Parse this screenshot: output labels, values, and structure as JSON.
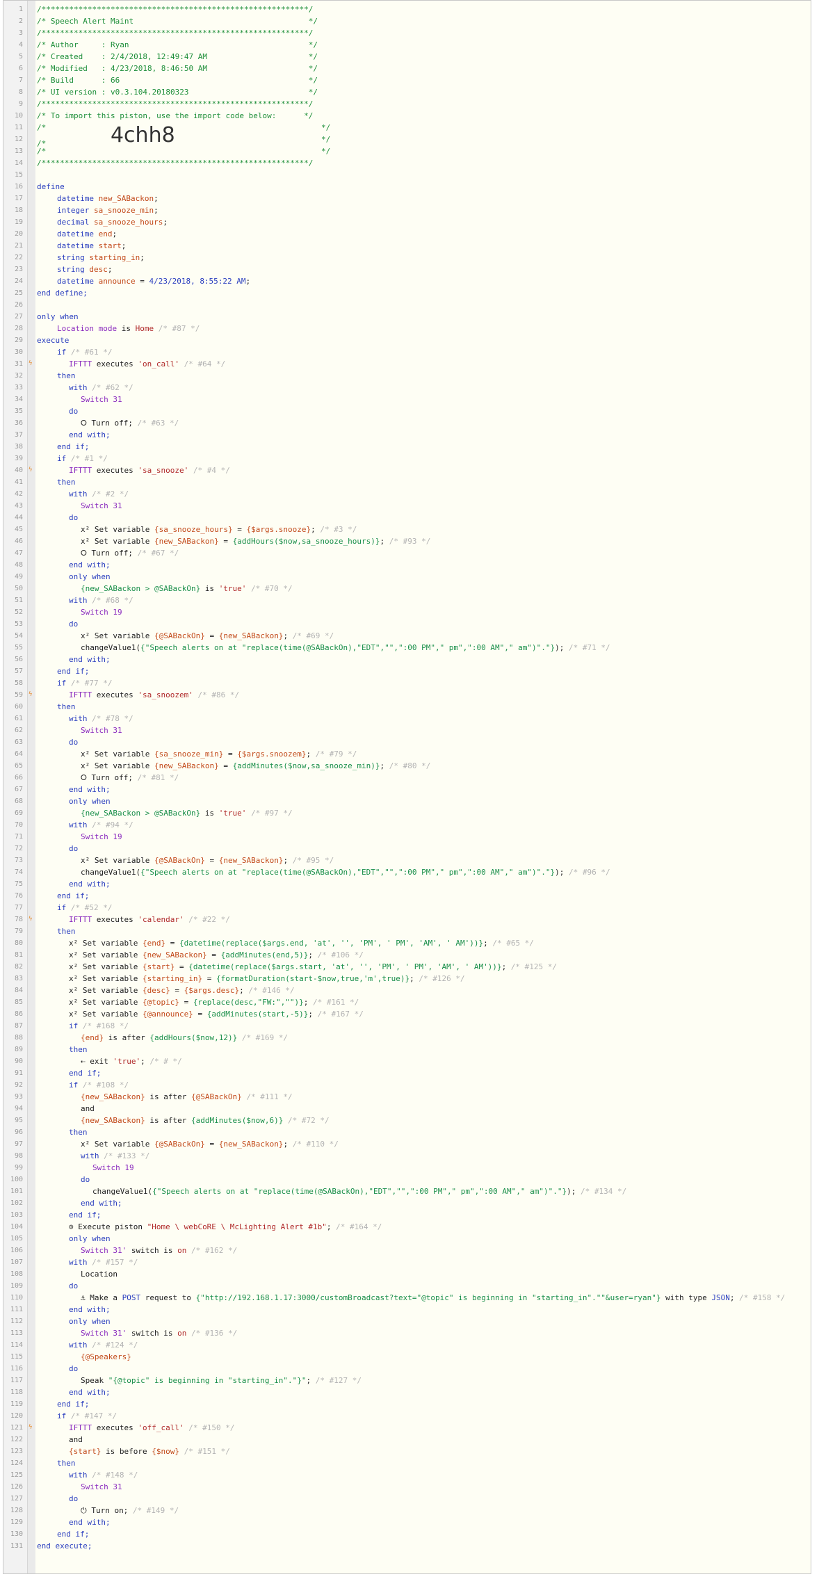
{
  "colors": {
    "comment": "#1f8f3a",
    "keyword": "#2b3fbf",
    "variable": "#c24a1a",
    "device": "#8a2bbe",
    "string": "#b02a2a",
    "expression": "#1a8f4a",
    "hint": "#b3b3b3"
  },
  "header": {
    "l1": "/**********************************************************/",
    "l2": "/* Speech Alert Maint                                      */",
    "l3": "/**********************************************************/",
    "l4": "/* Author     : Ryan                                       */",
    "l5": "/* Created    : 2/4/2018, 12:49:47 AM                      */",
    "l6": "/* Modified   : 4/23/2018, 8:46:50 AM                      */",
    "l7": "/* Build      : 66                                         */",
    "l8": "/* UI version : v0.3.104.20180323                          */",
    "l9": "/**********************************************************/",
    "l10": "/* To import this piston, use the import code below:      */",
    "l11a": "/*",
    "l11b": "*/",
    "l12a": "/*",
    "l12b": "*/",
    "l13a": "/*",
    "l13b": "*/",
    "import_code": "4chh8",
    "l14": "/**********************************************************/"
  },
  "define": {
    "open": "define",
    "close": "end define;",
    "vars": [
      {
        "type": "datetime",
        "name": "new_SABackon"
      },
      {
        "type": "integer",
        "name": "sa_snooze_min"
      },
      {
        "type": "decimal",
        "name": "sa_snooze_hours"
      },
      {
        "type": "datetime",
        "name": "end"
      },
      {
        "type": "datetime",
        "name": "start"
      },
      {
        "type": "string",
        "name": "starting_in"
      },
      {
        "type": "string",
        "name": "desc"
      }
    ],
    "announce": {
      "type": "datetime",
      "name": "announce",
      "value": "4/23/2018, 8:55:22 AM"
    }
  },
  "only_when": {
    "kw": "only when",
    "subject": "Location mode",
    "is": "is",
    "value": "Home",
    "id": "/* #87 */"
  },
  "lines": {
    "execute": "execute",
    "end_execute": "end execute;",
    "if": "if",
    "then": "then",
    "end_if": "end if;",
    "with": "with",
    "do": "do",
    "end_with": "end with;",
    "only_when": "only when",
    "and": "and",
    "switch31": "Switch 31",
    "switch19": "Switch 19",
    "ifttt": "IFTTT",
    "executes": "executes",
    "turn_off": "Turn off;",
    "turn_on": "Turn on;",
    "set_variable": "Set variable",
    "is_true": "is",
    "true_str": "'true'",
    "is_after": "is after",
    "is_before": "is before",
    "location": "Location",
    "speakers": "{@Speakers}",
    "switch31q": "Switch 31'",
    "switch_word": "switch",
    "is_on": "is",
    "on": "on"
  },
  "blocks": {
    "c61": "/* #61 */",
    "e_oncall": "'on_call'",
    "c64": "/* #64 */",
    "c62": "/* #62 */",
    "c63": "/* #63 */",
    "c1": "/* #1 */",
    "e_sasnooze": "'sa_snooze'",
    "c4": "/* #4 */",
    "c2": "/* #2 */",
    "v_hours": "{sa_snooze_hours}",
    "x_hours": "{$args.snooze}",
    "c3": "/* #3 */",
    "v_new": "{new_SABackon}",
    "x_addhours": "{addHours($now,sa_snooze_hours)}",
    "c93": "/* #93 */",
    "c67": "/* #67 */",
    "x_cond": "{new_SABackon > @SABackOn}",
    "c70": "/* #70 */",
    "c68": "/* #68 */",
    "v_sab": "{@SABackOn}",
    "x_new": "{new_SABackon}",
    "c69": "/* #69 */",
    "change": "changeValue1(",
    "change_arg": "{\"Speech alerts on at \"replace(time(@SABackOn),\"EDT\",\"\",\":00 PM\",\" pm\",\":00 AM\",\" am\")\".\"}",
    "change_end": ");",
    "c71": "/* #71 */",
    "c77": "/* #77 */",
    "e_sasnoozem": "'sa_snoozem'",
    "c86": "/* #86 */",
    "c78": "/* #78 */",
    "v_min": "{sa_snooze_min}",
    "x_min": "{$args.snoozem}",
    "c79": "/* #79 */",
    "x_addmin": "{addMinutes($now,sa_snooze_min)}",
    "c80": "/* #80 */",
    "c81": "/* #81 */",
    "c97": "/* #97 */",
    "c94": "/* #94 */",
    "c95": "/* #95 */",
    "c96": "/* #96 */",
    "c52": "/* #52 */",
    "e_calendar": "'calendar'",
    "c22": "/* #22 */",
    "v_end": "{end}",
    "x_end": "{datetime(replace($args.end, 'at', '', 'PM', ' PM', 'AM', ' AM'))}",
    "c65": "/* #65 */",
    "x_addend": "{addMinutes(end,5)}",
    "c106": "/* #106 */",
    "v_start": "{start}",
    "x_start": "{datetime(replace($args.start, 'at', '', 'PM', ' PM', 'AM', ' AM'))}",
    "c125": "/* #125 */",
    "v_startin": "{starting_in}",
    "x_startin": "{formatDuration(start-$now,true,'m',true)}",
    "c126": "/* #126 */",
    "v_desc": "{desc}",
    "x_desc": "{$args.desc}",
    "c146": "/* #146 */",
    "v_topic": "{@topic}",
    "x_topic": "{replace(desc,\"FW:\",\"\")}",
    "c161": "/* #161 */",
    "v_announce": "{@announce}",
    "x_announce": "{addMinutes(start,-5)}",
    "c167": "/* #167 */",
    "c168": "/* #168 */",
    "x_addhours12": "{addHours($now,12)}",
    "c169": "/* #169 */",
    "exit": "exit",
    "c0": "/* # */",
    "c108": "/* #108 */",
    "c111": "/* #111 */",
    "x_addmin6": "{addMinutes($now,6)}",
    "c72": "/* #72 */",
    "c110": "/* #110 */",
    "c133": "/* #133 */",
    "c134": "/* #134 */",
    "exec_piston": "Execute piston",
    "piston_name": "\"Home \\ webCoRE \\ McLighting Alert #1b\"",
    "c164": "/* #164 */",
    "c162": "/* #162 */",
    "c157": "/* #157 */",
    "post_a": "Make a",
    "post_m": "POST",
    "post_b": "request to",
    "post_url": "{\"http://192.168.1.17:3000/customBroadcast?text=\"@topic\" is beginning in \"starting_in\".\"\"&user=ryan\"}",
    "post_c": "with type",
    "post_t": "JSON",
    "c158": "/* #158 */",
    "c136": "/* #136 */",
    "c124": "/* #124 */",
    "speak": "Speak",
    "speak_arg": "\"{@topic\" is beginning in \"starting_in\".\"}\"",
    "c127": "/* #127 */",
    "c147": "/* #147 */",
    "e_offcall": "'off_call'",
    "c150": "/* #150 */",
    "v_now": "{$now}",
    "c151": "/* #151 */",
    "c148": "/* #148 */",
    "c149": "/* #149 */"
  }
}
